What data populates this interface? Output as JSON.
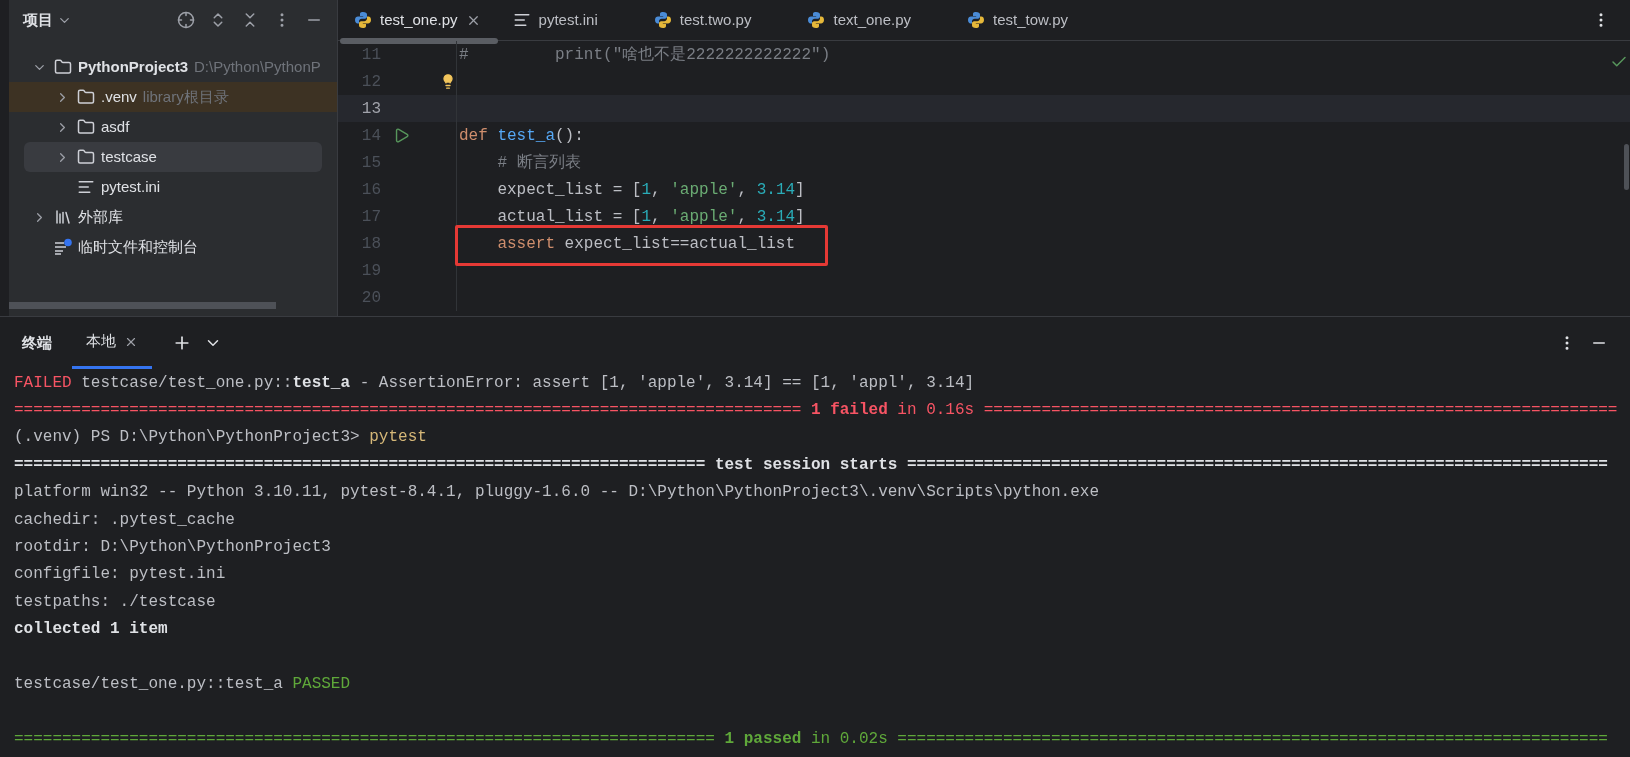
{
  "project_panel": {
    "title": "项目",
    "tree": [
      {
        "label": "PythonProject3",
        "hint": "D:\\Python\\PythonP",
        "kind": "folder",
        "bold": true,
        "expanded": true,
        "selected": false,
        "marked": false,
        "children": [
          {
            "label": ".venv",
            "hint": "library根目录",
            "kind": "folder",
            "expanded": false,
            "selected": false,
            "marked": true
          },
          {
            "label": "asdf",
            "kind": "folder",
            "expanded": false,
            "selected": false,
            "marked": false
          },
          {
            "label": "testcase",
            "kind": "folder",
            "expanded": false,
            "selected": true,
            "marked": false
          },
          {
            "label": "pytest.ini",
            "kind": "file",
            "selected": false,
            "marked": false
          }
        ]
      },
      {
        "label": "外部库",
        "kind": "library",
        "expanded": false,
        "selected": false,
        "marked": false
      },
      {
        "label": "临时文件和控制台",
        "kind": "scratch",
        "selected": false,
        "marked": false
      }
    ]
  },
  "editor_tabs": [
    {
      "label": "test_one.py",
      "kind": "python",
      "selected": true
    },
    {
      "label": "pytest.ini",
      "kind": "ini",
      "selected": false
    },
    {
      "label": "test.two.py",
      "kind": "python",
      "selected": false
    },
    {
      "label": "text_one.py",
      "kind": "python",
      "selected": false
    },
    {
      "label": "test_tow.py",
      "kind": "python",
      "selected": false
    }
  ],
  "code_lines": [
    {
      "number": "11",
      "current": false,
      "tokens": [
        {
          "text": "#         print(\"啥也不是2222222222222\")",
          "kind": "comment"
        }
      ]
    },
    {
      "number": "12",
      "current": false,
      "bulb": true
    },
    {
      "number": "13",
      "current": true
    },
    {
      "number": "14",
      "current": false,
      "run_button": true,
      "tokens": [
        {
          "text": "def ",
          "kind": "keyword"
        },
        {
          "text": "test_a",
          "kind": "function"
        },
        {
          "text": "():",
          "kind": "plain"
        }
      ]
    },
    {
      "number": "15",
      "current": false,
      "tokens": [
        {
          "text": "    # 断言列表",
          "kind": "comment"
        }
      ]
    },
    {
      "number": "16",
      "current": false,
      "tokens": [
        {
          "text": "    expect_list = [",
          "kind": "plain"
        },
        {
          "text": "1",
          "kind": "number"
        },
        {
          "text": ", ",
          "kind": "plain"
        },
        {
          "text": "'apple'",
          "kind": "string"
        },
        {
          "text": ", ",
          "kind": "plain"
        },
        {
          "text": "3.14",
          "kind": "number"
        },
        {
          "text": "]",
          "kind": "plain"
        }
      ]
    },
    {
      "number": "17",
      "current": false,
      "tokens": [
        {
          "text": "    actual_list = [",
          "kind": "plain"
        },
        {
          "text": "1",
          "kind": "number"
        },
        {
          "text": ", ",
          "kind": "plain"
        },
        {
          "text": "'apple'",
          "kind": "string"
        },
        {
          "text": ", ",
          "kind": "plain"
        },
        {
          "text": "3.14",
          "kind": "number"
        },
        {
          "text": "]",
          "kind": "plain"
        }
      ]
    },
    {
      "number": "18",
      "current": false,
      "boxed": true,
      "tokens": [
        {
          "text": "    assert",
          "kind": "keyword"
        },
        {
          "text": " expect_list==actual_list",
          "kind": "plain"
        }
      ]
    },
    {
      "number": "19",
      "current": false
    },
    {
      "number": "20",
      "current": false
    }
  ],
  "terminal": {
    "title": "终端",
    "tabs": [
      {
        "label": "本地",
        "selected": true
      }
    ],
    "lines": [
      [
        {
          "text": "FAILED",
          "kind": "error"
        },
        {
          "text": " testcase/test_one.py::",
          "kind": "plain"
        },
        {
          "text": "test_a",
          "kind": "bold"
        },
        {
          "text": " - AssertionError: assert [1, 'apple', 3.14] == [1, 'appl', 3.14]",
          "kind": "plain"
        }
      ],
      [
        {
          "text": "================================================================================== ",
          "kind": "error"
        },
        {
          "text": "1 failed",
          "kind": "error-bold"
        },
        {
          "text": " in 0.16s ==================================================================",
          "kind": "error"
        }
      ],
      [
        {
          "text": "(.venv) PS D:\\Python\\PythonProject3> ",
          "kind": "plain"
        },
        {
          "text": "pytest",
          "kind": "command"
        }
      ],
      [
        {
          "text": "======================================================================== test session starts =========================================================================",
          "kind": "bold"
        }
      ],
      [
        {
          "text": "platform win32 -- Python 3.10.11, pytest-8.4.1, pluggy-1.6.0 -- D:\\Python\\PythonProject3\\.venv\\Scripts\\python.exe",
          "kind": "plain"
        }
      ],
      [
        {
          "text": "cachedir: .pytest_cache",
          "kind": "plain"
        }
      ],
      [
        {
          "text": "rootdir: D:\\Python\\PythonProject3",
          "kind": "plain"
        }
      ],
      [
        {
          "text": "configfile: pytest.ini",
          "kind": "plain"
        }
      ],
      [
        {
          "text": "testpaths: ./testcase",
          "kind": "plain"
        }
      ],
      [
        {
          "text": "collected 1 item",
          "kind": "bold"
        }
      ],
      [
        {
          "gap_before": true
        },
        {
          "text": "testcase/test_one.py::test_a ",
          "kind": "plain"
        },
        {
          "text": "PASSED",
          "kind": "success"
        }
      ],
      [
        {
          "gap_before": true
        },
        {
          "text": "========================================================================= ",
          "kind": "success"
        },
        {
          "text": "1 passed",
          "kind": "success-bold"
        },
        {
          "text": " in 0.02s ==========================================================================",
          "kind": "success"
        }
      ]
    ]
  }
}
